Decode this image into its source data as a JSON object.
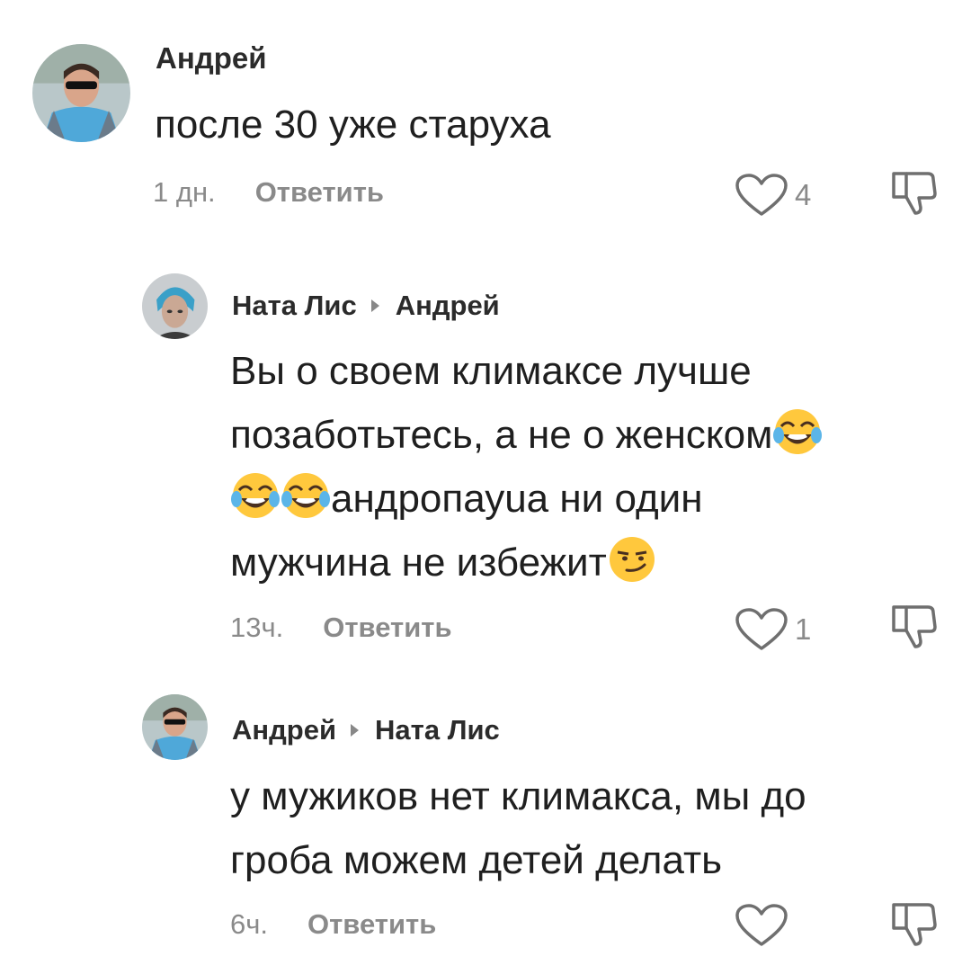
{
  "comments": [
    {
      "author": "Андрей",
      "text": "после 30 уже старуха",
      "time": "1 дн.",
      "reply_label": "Ответить",
      "likes": "4",
      "avatar_icon": "user-avatar-andrey-icon"
    },
    {
      "author": "Ната Лис",
      "reply_to": "Андрей",
      "text_parts": [
        "Вы о своем климаксе лучше",
        "позаботьтесь, а не о женском",
        "андропауua ни один",
        "мужчина не избежит"
      ],
      "time": "13ч.",
      "reply_label": "Ответить",
      "likes": "1",
      "avatar_icon": "user-avatar-nata-icon"
    },
    {
      "author": "Андрей",
      "reply_to": "Ната Лис",
      "text_lines": [
        "у мужиков нет климакса, мы до",
        "гроба можем детей делать"
      ],
      "time": "6ч.",
      "reply_label": "Ответить",
      "likes": "",
      "avatar_icon": "user-avatar-andrey-icon"
    }
  ],
  "colors": {
    "text": "#1f1f1f",
    "muted": "#8a8a8a",
    "emoji_face": "#ffc83d"
  }
}
